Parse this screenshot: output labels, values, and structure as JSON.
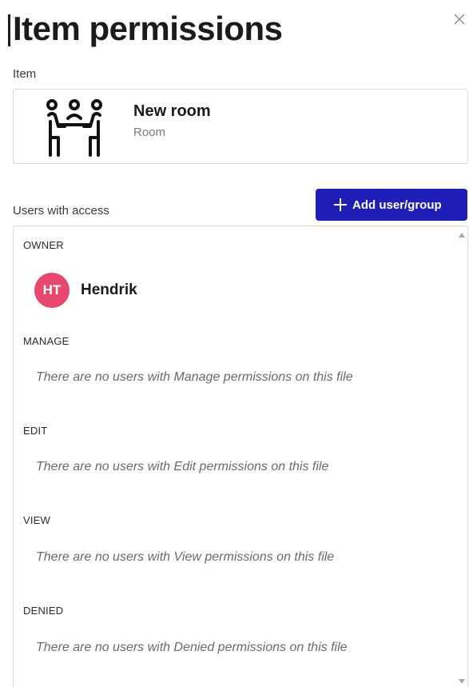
{
  "header": {
    "title": "Item permissions"
  },
  "item": {
    "section_label": "Item",
    "name": "New room",
    "type": "Room",
    "icon": "meeting-room-icon"
  },
  "access": {
    "section_label": "Users with access",
    "add_button_label": "Add user/group",
    "groups": {
      "owner": {
        "heading": "OWNER",
        "user": {
          "initials": "HT",
          "name": "Hendrik",
          "avatar_color": "#e8476e"
        }
      },
      "manage": {
        "heading": "MANAGE",
        "empty_message": "There are no users with Manage permissions on this file"
      },
      "edit": {
        "heading": "EDIT",
        "empty_message": "There are no users with Edit permissions on this file"
      },
      "view": {
        "heading": "VIEW",
        "empty_message": "There are no users with View permissions on this file"
      },
      "denied": {
        "heading": "DENIED",
        "empty_message": "There are no users with Denied permissions on this file"
      }
    }
  },
  "colors": {
    "accent": "#1f1fb8",
    "avatar": "#e8476e"
  }
}
